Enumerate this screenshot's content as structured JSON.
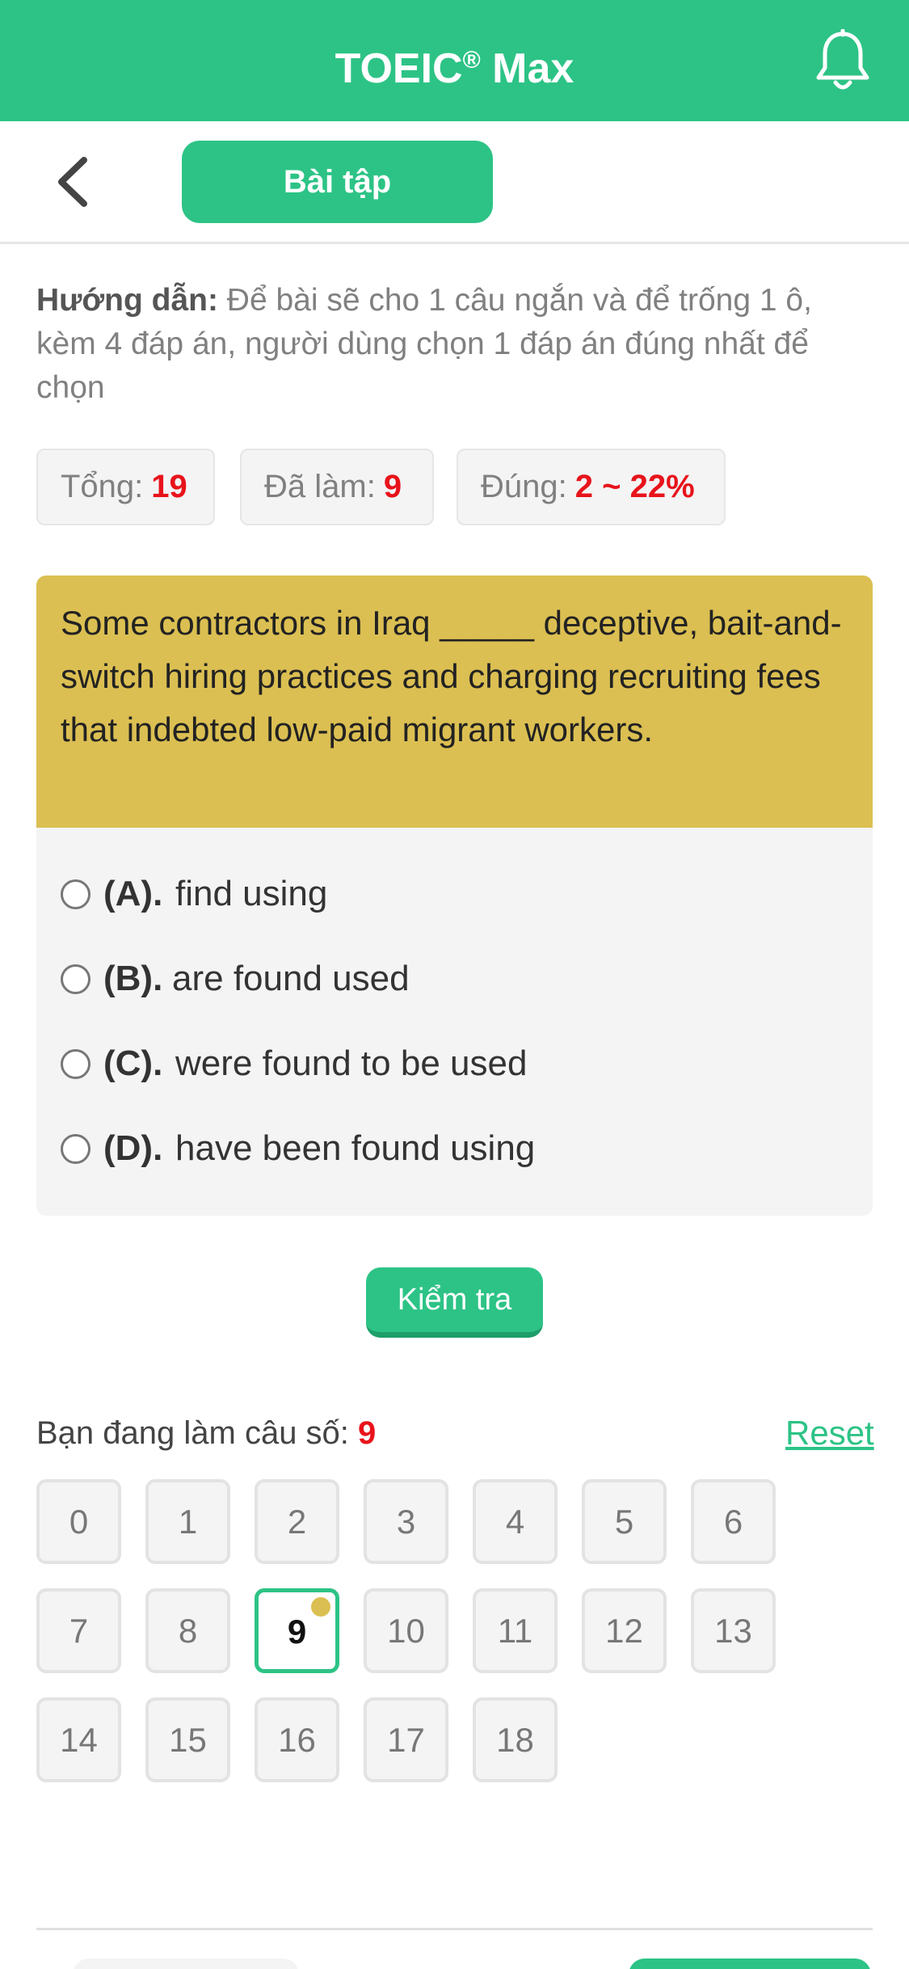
{
  "header": {
    "title": "TOEIC",
    "title_mark": "®",
    "title_suffix": " Max",
    "notification_icon": "bell-icon"
  },
  "subheader": {
    "back_icon": "chevron-left-icon",
    "tab_label": "Bài tập"
  },
  "instructions": {
    "label": "Hướng dẫn:",
    "text": " Để bài sẽ cho 1 câu ngắn và để trống 1 ô, kèm 4 đáp án, người dùng chọn 1 đáp án đúng nhất để chọn"
  },
  "stats": {
    "total_label": "Tổng:",
    "total_value": "19",
    "done_label": "Đã làm:",
    "done_value": "9",
    "correct_label": "Đúng:",
    "correct_value": "2 ~ 22%"
  },
  "question": {
    "text": "Some contractors in Iraq _____ deceptive, bait-and-switch hiring practices and charging recruiting fees that indebted low-paid migrant workers."
  },
  "answers": [
    {
      "letter": "(A).",
      "text": "find using"
    },
    {
      "letter": "(B).",
      "text": "are found used"
    },
    {
      "letter": "(C).",
      "text": "were found to be used"
    },
    {
      "letter": "(D).",
      "text": "have been found using"
    }
  ],
  "check_button": "Kiểm tra",
  "progress": {
    "label": "Bạn đang làm câu số:",
    "current": "9",
    "reset_label": "Reset"
  },
  "grid": [
    "0",
    "1",
    "2",
    "3",
    "4",
    "5",
    "6",
    "7",
    "8",
    "9",
    "10",
    "11",
    "12",
    "13",
    "14",
    "15",
    "16",
    "17",
    "18"
  ],
  "colors": {
    "accent": "#2dc386",
    "question_bg": "#dbbf52",
    "highlight": "#e8131b"
  }
}
